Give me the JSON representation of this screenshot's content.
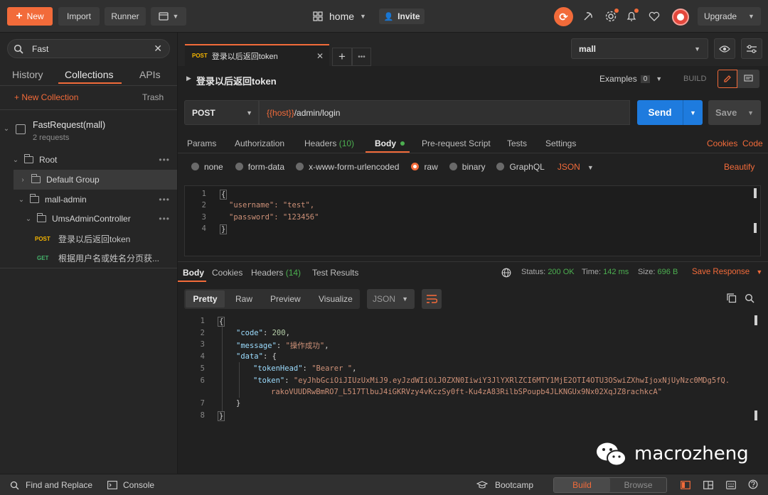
{
  "topbar": {
    "new_label": "New",
    "import_label": "Import",
    "runner_label": "Runner",
    "workspace_label": "home",
    "invite_label": "Invite",
    "upgrade_label": "Upgrade"
  },
  "sidebar": {
    "search_value": "Fast",
    "tabs": [
      "History",
      "Collections",
      "APIs"
    ],
    "active_tab": "Collections",
    "new_collection_label": "+ New Collection",
    "trash_label": "Trash",
    "collection": {
      "name": "FastRequest(mall)",
      "subtitle": "2 requests"
    },
    "tree": [
      {
        "label": "Root"
      },
      {
        "label": "Default Group"
      },
      {
        "label": "mall-admin"
      },
      {
        "label": "UmsAdminController"
      },
      {
        "method": "POST",
        "label": "登录以后返回token"
      },
      {
        "method": "GET",
        "label": "根据用户名或姓名分页获..."
      }
    ]
  },
  "request_tab": {
    "method": "POST",
    "title": "登录以后返回token"
  },
  "environment": {
    "selected": "mall"
  },
  "request": {
    "title": "登录以后返回token",
    "examples_label": "Examples",
    "examples_count": "0",
    "build_label": "BUILD",
    "method": "POST",
    "url_var": "{{host}}",
    "url_path": "/admin/login",
    "send_label": "Send",
    "save_label": "Save",
    "tabs": {
      "params": "Params",
      "authorization": "Authorization",
      "headers": "Headers",
      "headers_count": "(10)",
      "body": "Body",
      "prerequest": "Pre-request Script",
      "tests": "Tests",
      "settings": "Settings"
    },
    "cookies_link": "Cookies",
    "code_link": "Code",
    "body_types": [
      "none",
      "form-data",
      "x-www-form-urlencoded",
      "raw",
      "binary",
      "GraphQL"
    ],
    "body_selected": "raw",
    "body_format": "JSON",
    "beautify_label": "Beautify",
    "body_lines": [
      "{",
      "\"username\": \"test\",",
      "\"password\": \"123456\"",
      "}"
    ]
  },
  "response": {
    "tabs": {
      "body": "Body",
      "cookies": "Cookies",
      "headers": "Headers",
      "headers_count": "(14)",
      "test_results": "Test Results"
    },
    "status_label": "Status:",
    "status_value": "200 OK",
    "time_label": "Time:",
    "time_value": "142 ms",
    "size_label": "Size:",
    "size_value": "696 B",
    "save_response_label": "Save Response",
    "view_tabs": [
      "Pretty",
      "Raw",
      "Preview",
      "Visualize"
    ],
    "active_view": "Pretty",
    "format": "JSON",
    "code": {
      "code_key": "\"code\"",
      "code_val": "200",
      "message_key": "\"message\"",
      "message_val": "\"操作成功\"",
      "data_key": "\"data\"",
      "tokenhead_key": "\"tokenHead\"",
      "tokenhead_val": "\"Bearer \"",
      "token_key": "\"token\"",
      "token_val_1": "\"eyJhbGciOiJIUzUxMiJ9.eyJzdWIiOiJ0ZXN0IiwiY3JlYXRlZCI6MTY1MjE2OTI4OTU3OSwiZXhwIjoxNjUyNzc0MDg5fQ.",
      "token_val_2": "rakoVUUDRwBmRO7_L517TlbuJ4iGKRVzy4vKczSy0ft-Ku4zA83RilbSPoupb4JLKNGUx9Nx02XqJZ8rachkcA\""
    }
  },
  "watermark": "macrozheng",
  "bottombar": {
    "find_replace": "Find and Replace",
    "console": "Console",
    "bootcamp": "Bootcamp",
    "build": "Build",
    "browse": "Browse"
  },
  "colors": {
    "accent": "#f26b3a",
    "send_blue": "#1e7bde",
    "success_green": "#4caf50"
  }
}
